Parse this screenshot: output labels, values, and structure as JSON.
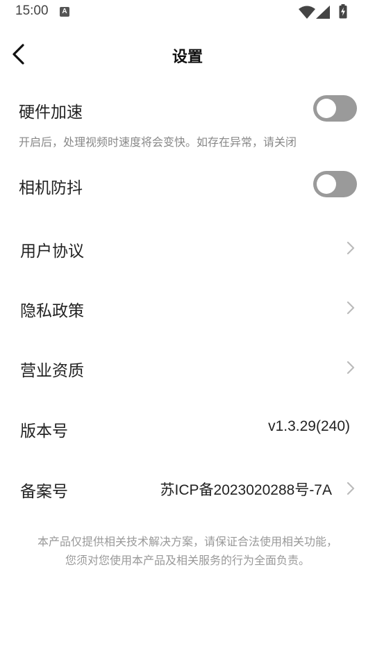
{
  "status_bar": {
    "time": "15:00",
    "notification_icon": "A"
  },
  "header": {
    "title": "设置"
  },
  "settings": {
    "hardware_acceleration": {
      "label": "硬件加速",
      "description": "开启后，处理视频时速度将会变快。如存在异常，请关闭",
      "enabled": false
    },
    "camera_stabilization": {
      "label": "相机防抖",
      "enabled": false
    },
    "user_agreement": {
      "label": "用户协议"
    },
    "privacy_policy": {
      "label": "隐私政策"
    },
    "business_qualification": {
      "label": "营业资质"
    },
    "version": {
      "label": "版本号",
      "value": "v1.3.29(240)"
    },
    "icp_record": {
      "label": "备案号",
      "value": "苏ICP备2023020288号-7A"
    }
  },
  "footer": {
    "line1": "本产品仅提供相关技术解决方案，请保证合法使用相关功能，",
    "line2": "您须对您使用本产品及相关服务的行为全面负责。"
  },
  "icons": {
    "back": "chevron-left-icon",
    "row_arrow": "chevron-right-icon",
    "wifi": "wifi-icon",
    "signal": "cell-signal-icon",
    "battery": "battery-charging-icon"
  },
  "colors": {
    "toggle_off": "#9a9a9a",
    "secondary_text": "#888888",
    "footer_text": "#999999",
    "chevron": "#bbbbbb"
  }
}
